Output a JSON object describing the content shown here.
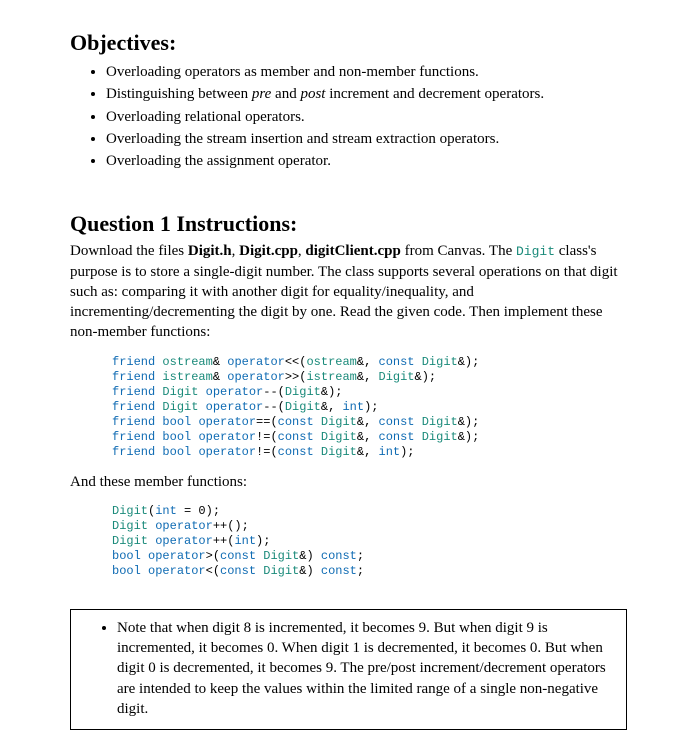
{
  "objectives_heading": "Objectives:",
  "objectives": [
    {
      "pre": "Overloading operators as member and non-member functions.",
      "em": "",
      "post": ""
    },
    {
      "pre": "Distinguishing between ",
      "em": "pre",
      "mid": " and ",
      "em2": "post",
      "post": " increment and decrement operators."
    },
    {
      "pre": "Overloading relational operators.",
      "em": "",
      "post": ""
    },
    {
      "pre": "Overloading the stream insertion and stream extraction operators.",
      "em": "",
      "post": ""
    },
    {
      "pre": "Overloading the assignment operator.",
      "em": "",
      "post": ""
    }
  ],
  "question_heading": "Question 1 Instructions:",
  "intro_paragraph": {
    "pre": "Download the files ",
    "b1": "Digit.h",
    "sep1": ", ",
    "b2": "Digit.cpp",
    "sep2": ", ",
    "b3": "digitClient.cpp",
    "mid": " from Canvas.  The ",
    "code": "Digit",
    "post": " class's purpose is to store a single-digit number.  The class supports several operations on that digit such as: comparing it with another digit for equality/inequality, and incrementing/decrementing the digit by one.  Read the given code.  Then implement these non-member functions:"
  },
  "nonmember_lines": [
    [
      {
        "t": "friend ",
        "c": "kw"
      },
      {
        "t": "ostream",
        "c": "cls"
      },
      {
        "t": "& ",
        "c": ""
      },
      {
        "t": "operator",
        "c": "kw"
      },
      {
        "t": "<<(",
        "c": ""
      },
      {
        "t": "ostream",
        "c": "cls"
      },
      {
        "t": "&, ",
        "c": ""
      },
      {
        "t": "const ",
        "c": "kw"
      },
      {
        "t": "Digit",
        "c": "cls"
      },
      {
        "t": "&);",
        "c": ""
      }
    ],
    [
      {
        "t": "friend ",
        "c": "kw"
      },
      {
        "t": "istream",
        "c": "cls"
      },
      {
        "t": "& ",
        "c": ""
      },
      {
        "t": "operator",
        "c": "kw"
      },
      {
        "t": ">>(",
        "c": ""
      },
      {
        "t": "istream",
        "c": "cls"
      },
      {
        "t": "&, ",
        "c": ""
      },
      {
        "t": "Digit",
        "c": "cls"
      },
      {
        "t": "&);",
        "c": ""
      }
    ],
    [
      {
        "t": "friend ",
        "c": "kw"
      },
      {
        "t": "Digit",
        "c": "cls"
      },
      {
        "t": " ",
        "c": ""
      },
      {
        "t": "operator",
        "c": "kw"
      },
      {
        "t": "--(",
        "c": ""
      },
      {
        "t": "Digit",
        "c": "cls"
      },
      {
        "t": "&);",
        "c": ""
      }
    ],
    [
      {
        "t": "friend ",
        "c": "kw"
      },
      {
        "t": "Digit",
        "c": "cls"
      },
      {
        "t": " ",
        "c": ""
      },
      {
        "t": "operator",
        "c": "kw"
      },
      {
        "t": "--(",
        "c": ""
      },
      {
        "t": "Digit",
        "c": "cls"
      },
      {
        "t": "&, ",
        "c": ""
      },
      {
        "t": "int",
        "c": "kw"
      },
      {
        "t": ");",
        "c": ""
      }
    ],
    [
      {
        "t": "friend ",
        "c": "kw"
      },
      {
        "t": "bool",
        "c": "kw"
      },
      {
        "t": " ",
        "c": ""
      },
      {
        "t": "operator",
        "c": "kw"
      },
      {
        "t": "==(",
        "c": ""
      },
      {
        "t": "const ",
        "c": "kw"
      },
      {
        "t": "Digit",
        "c": "cls"
      },
      {
        "t": "&, ",
        "c": ""
      },
      {
        "t": "const ",
        "c": "kw"
      },
      {
        "t": "Digit",
        "c": "cls"
      },
      {
        "t": "&);",
        "c": ""
      }
    ],
    [
      {
        "t": "friend ",
        "c": "kw"
      },
      {
        "t": "bool",
        "c": "kw"
      },
      {
        "t": " ",
        "c": ""
      },
      {
        "t": "operator",
        "c": "kw"
      },
      {
        "t": "!=(",
        "c": ""
      },
      {
        "t": "const ",
        "c": "kw"
      },
      {
        "t": "Digit",
        "c": "cls"
      },
      {
        "t": "&, ",
        "c": ""
      },
      {
        "t": "const ",
        "c": "kw"
      },
      {
        "t": "Digit",
        "c": "cls"
      },
      {
        "t": "&);",
        "c": ""
      }
    ],
    [
      {
        "t": "friend ",
        "c": "kw"
      },
      {
        "t": "bool",
        "c": "kw"
      },
      {
        "t": " ",
        "c": ""
      },
      {
        "t": "operator",
        "c": "kw"
      },
      {
        "t": "!=(",
        "c": ""
      },
      {
        "t": "const ",
        "c": "kw"
      },
      {
        "t": "Digit",
        "c": "cls"
      },
      {
        "t": "&, ",
        "c": ""
      },
      {
        "t": "int",
        "c": "kw"
      },
      {
        "t": ");",
        "c": ""
      }
    ]
  ],
  "mid_text": "And these member functions:",
  "member_lines": [
    [
      {
        "t": "Digit",
        "c": "cls"
      },
      {
        "t": "(",
        "c": ""
      },
      {
        "t": "int",
        "c": "kw"
      },
      {
        "t": " = 0);",
        "c": ""
      }
    ],
    [
      {
        "t": "Digit",
        "c": "cls"
      },
      {
        "t": " ",
        "c": ""
      },
      {
        "t": "operator",
        "c": "kw"
      },
      {
        "t": "++();",
        "c": ""
      }
    ],
    [
      {
        "t": "Digit",
        "c": "cls"
      },
      {
        "t": " ",
        "c": ""
      },
      {
        "t": "operator",
        "c": "kw"
      },
      {
        "t": "++(",
        "c": ""
      },
      {
        "t": "int",
        "c": "kw"
      },
      {
        "t": ");",
        "c": ""
      }
    ],
    [
      {
        "t": "bool",
        "c": "kw"
      },
      {
        "t": " ",
        "c": ""
      },
      {
        "t": "operator",
        "c": "kw"
      },
      {
        "t": ">(",
        "c": ""
      },
      {
        "t": "const ",
        "c": "kw"
      },
      {
        "t": "Digit",
        "c": "cls"
      },
      {
        "t": "&) ",
        "c": ""
      },
      {
        "t": "const",
        "c": "kw"
      },
      {
        "t": ";",
        "c": ""
      }
    ],
    [
      {
        "t": "bool",
        "c": "kw"
      },
      {
        "t": " ",
        "c": ""
      },
      {
        "t": "operator",
        "c": "kw"
      },
      {
        "t": "<(",
        "c": ""
      },
      {
        "t": "const ",
        "c": "kw"
      },
      {
        "t": "Digit",
        "c": "cls"
      },
      {
        "t": "&) ",
        "c": ""
      },
      {
        "t": "const",
        "c": "kw"
      },
      {
        "t": ";",
        "c": ""
      }
    ]
  ],
  "note_text": "Note that when digit 8 is incremented, it becomes 9.  But when digit 9 is incremented, it becomes 0.  When digit 1 is decremented, it becomes 0.  But when digit 0 is decremented, it becomes 9.  The pre/post increment/decrement operators are intended to keep the values within the limited range of a single non-negative digit."
}
